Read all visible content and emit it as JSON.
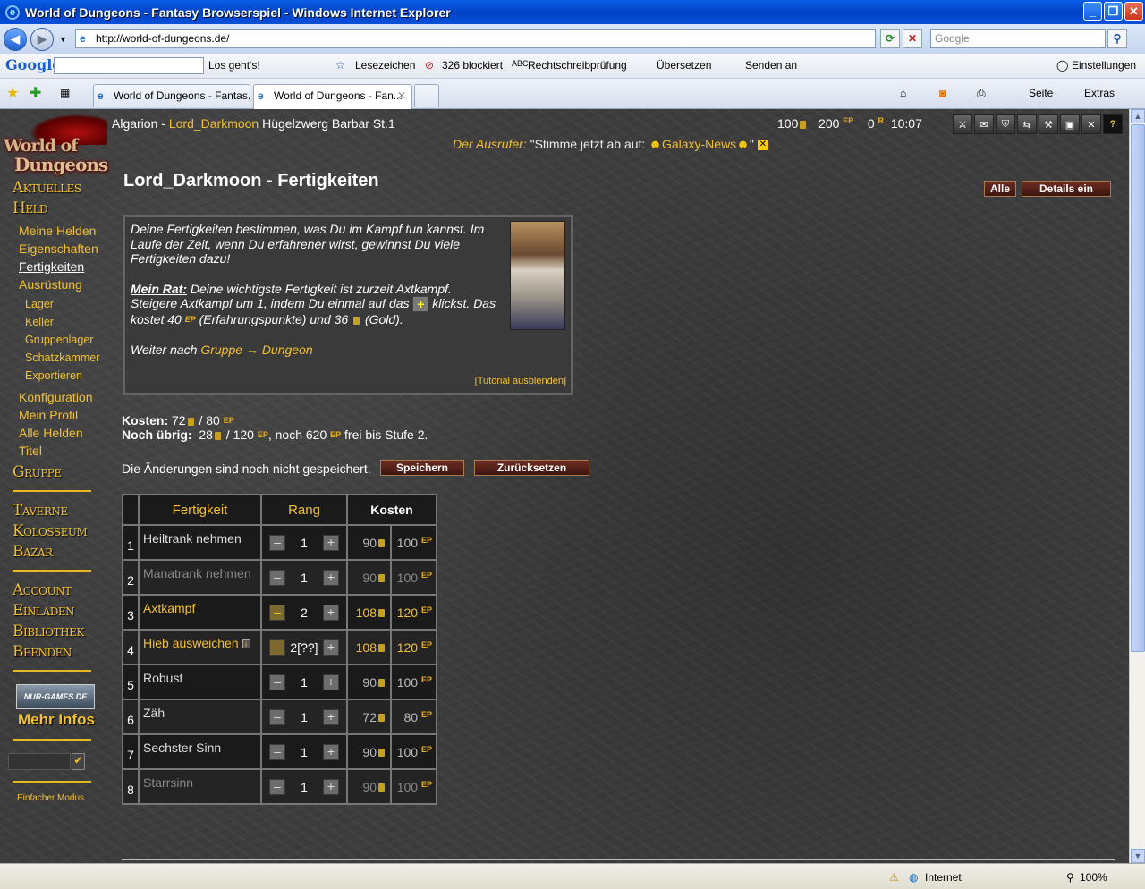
{
  "window": {
    "title": "World of Dungeons - Fantasy Browserspiel - Windows Internet Explorer",
    "min": "_",
    "max": "❐",
    "close": "✕"
  },
  "address": {
    "url": "http://world-of-dungeons.de/",
    "search_placeholder": "Google"
  },
  "toolbar": {
    "google": "Google",
    "go": "Los geht's!",
    "bookmarks": "Lesezeichen",
    "blocked": "326 blockiert",
    "spell": "Rechtschreibprüfung",
    "translate": "Übersetzen",
    "send": "Senden an",
    "settings": "Einstellungen"
  },
  "tabs": [
    {
      "label": "World of Dungeons - Fantas..."
    },
    {
      "label": "World of Dungeons - Fan..."
    }
  ],
  "tabtools": {
    "page": "Seite",
    "extras": "Extras"
  },
  "logo": {
    "line1": "World of",
    "line2": "Dungeons"
  },
  "sidebar": {
    "aktuelles": "Aktuelles",
    "held": "Held",
    "meine_helden": "Meine Helden",
    "eigenschaften": "Eigenschaften",
    "fertigkeiten": "Fertigkeiten",
    "ausruestung": "Ausrüstung",
    "lager": "Lager",
    "keller": "Keller",
    "gruppenlager": "Gruppenlager",
    "schatzkammer": "Schatzkammer",
    "exportieren": "Exportieren",
    "konfiguration": "Konfiguration",
    "mein_profil": "Mein Profil",
    "alle_helden": "Alle Helden",
    "titel": "Titel",
    "gruppe": "Gruppe",
    "taverne": "Taverne",
    "kolosseum": "Kolosseum",
    "bazar": "Bazar",
    "account": "Account",
    "einladen": "Einladen",
    "bibliothek": "Bibliothek",
    "beenden": "Beenden",
    "nur_games": "NUR-GAMES.DE",
    "mehr_infos": "Mehr Infos",
    "einfacher_modus": "Einfacher Modus"
  },
  "header": {
    "world": "Algarion",
    "sep": " - ",
    "hero": "Lord_Darkmoon",
    "desc": " Hügelzwerg Barbar St.1",
    "gold": "100",
    "ep_val": "200",
    "ep": "EP",
    "r_val": "0",
    "r": "R",
    "time": "10:07"
  },
  "herald": {
    "label": "Der Ausrufer:",
    "text": " \"Stimme jetzt ab auf: ",
    "link": "Galaxy-News",
    "end": "\""
  },
  "page": {
    "title": "Lord_Darkmoon - Fertigkeiten",
    "btn_all": "Alle",
    "btn_details": "Details ein"
  },
  "tutorial": {
    "p1": "Deine Fertigkeiten bestimmen, was Du im Kampf tun kannst. Im Laufe der Zeit, wenn Du erfahrener wirst, gewinnst Du viele Fertigkeiten dazu!",
    "rat_label": "Mein Rat:",
    "rat_a": " Deine wichtigste Fertigkeit ist zurzeit Axtkampf. Steigere Axtkampf um 1, indem Du einmal auf das ",
    "rat_b": " klickst. Das kostet 40 ",
    "rat_c": " (Erfahrungspunkte) und 36 ",
    "rat_d": " (Gold).",
    "weiter": "Weiter nach ",
    "weiter_link": "Gruppe → Dungeon",
    "hide": "[Tutorial ausblenden]"
  },
  "costs": {
    "label": "Kosten:",
    "gold": "72",
    "slash": " /  ",
    "ep": "80",
    "rest_label": "Noch übrig:",
    "rest_gold": "28",
    "rest_slash": " / 120 ",
    "rest_tail": ", noch 620 ",
    "rest_end": " frei bis Stufe 2."
  },
  "save": {
    "text": "Die Änderungen sind noch nicht gespeichert.",
    "save_btn": "Speichern",
    "reset_btn": "Zurücksetzen"
  },
  "table": {
    "headers": {
      "skill": "Fertigkeit",
      "rank": "Rang",
      "cost": "Kosten"
    },
    "rows": [
      {
        "n": "1",
        "name": "Heiltrank nehmen",
        "rank": "1",
        "gold": "90",
        "ep": "100"
      },
      {
        "n": "2",
        "name": "Manatrank nehmen",
        "rank": "1",
        "gold": "90",
        "ep": "100"
      },
      {
        "n": "3",
        "name": "Axtkampf",
        "rank": "2",
        "gold": "108",
        "ep": "120"
      },
      {
        "n": "4",
        "name": "Hieb ausweichen",
        "rank": "2[??]",
        "gold": "108",
        "ep": "120"
      },
      {
        "n": "5",
        "name": "Robust",
        "rank": "1",
        "gold": "90",
        "ep": "100"
      },
      {
        "n": "6",
        "name": "Zäh",
        "rank": "1",
        "gold": "72",
        "ep": "80"
      },
      {
        "n": "7",
        "name": "Sechster Sinn",
        "rank": "1",
        "gold": "90",
        "ep": "100"
      },
      {
        "n": "8",
        "name": "Starrsinn",
        "rank": "1",
        "gold": "90",
        "ep": "100"
      }
    ]
  },
  "status": {
    "zone": "Internet",
    "zoom": "100%"
  }
}
